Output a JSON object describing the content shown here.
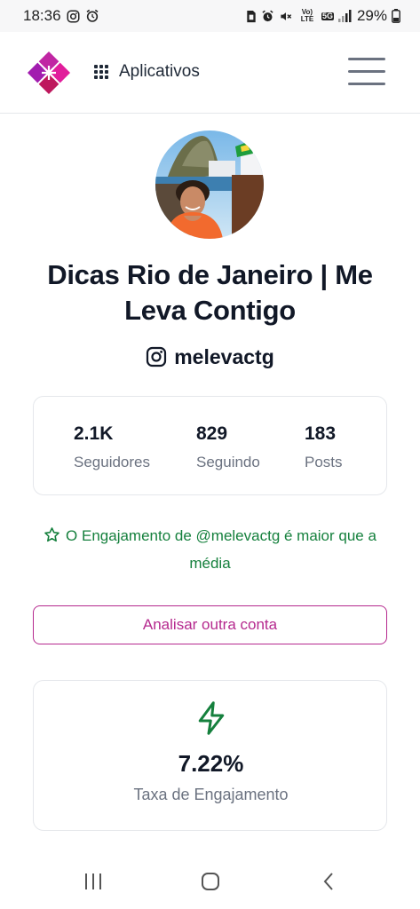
{
  "status_bar": {
    "time": "18:36",
    "battery": "29%",
    "network": "5G",
    "volte": "Vo) LTE"
  },
  "header": {
    "apps_label": "Aplicativos"
  },
  "profile": {
    "name": "Dicas Rio de Janeiro | Me Leva Contigo",
    "handle": "melevactg"
  },
  "stats": [
    {
      "value": "2.1K",
      "label": "Seguidores"
    },
    {
      "value": "829",
      "label": "Seguindo"
    },
    {
      "value": "183",
      "label": "Posts"
    }
  ],
  "engagement_note": "O Engajamento de @melevactg é maior que a média",
  "analyze_button": "Analisar outra conta",
  "engagement_rate": {
    "value": "7.22%",
    "label": "Taxa de Engajamento"
  },
  "colors": {
    "accent": "#b5298e",
    "success": "#15803d",
    "muted": "#6b7280"
  }
}
